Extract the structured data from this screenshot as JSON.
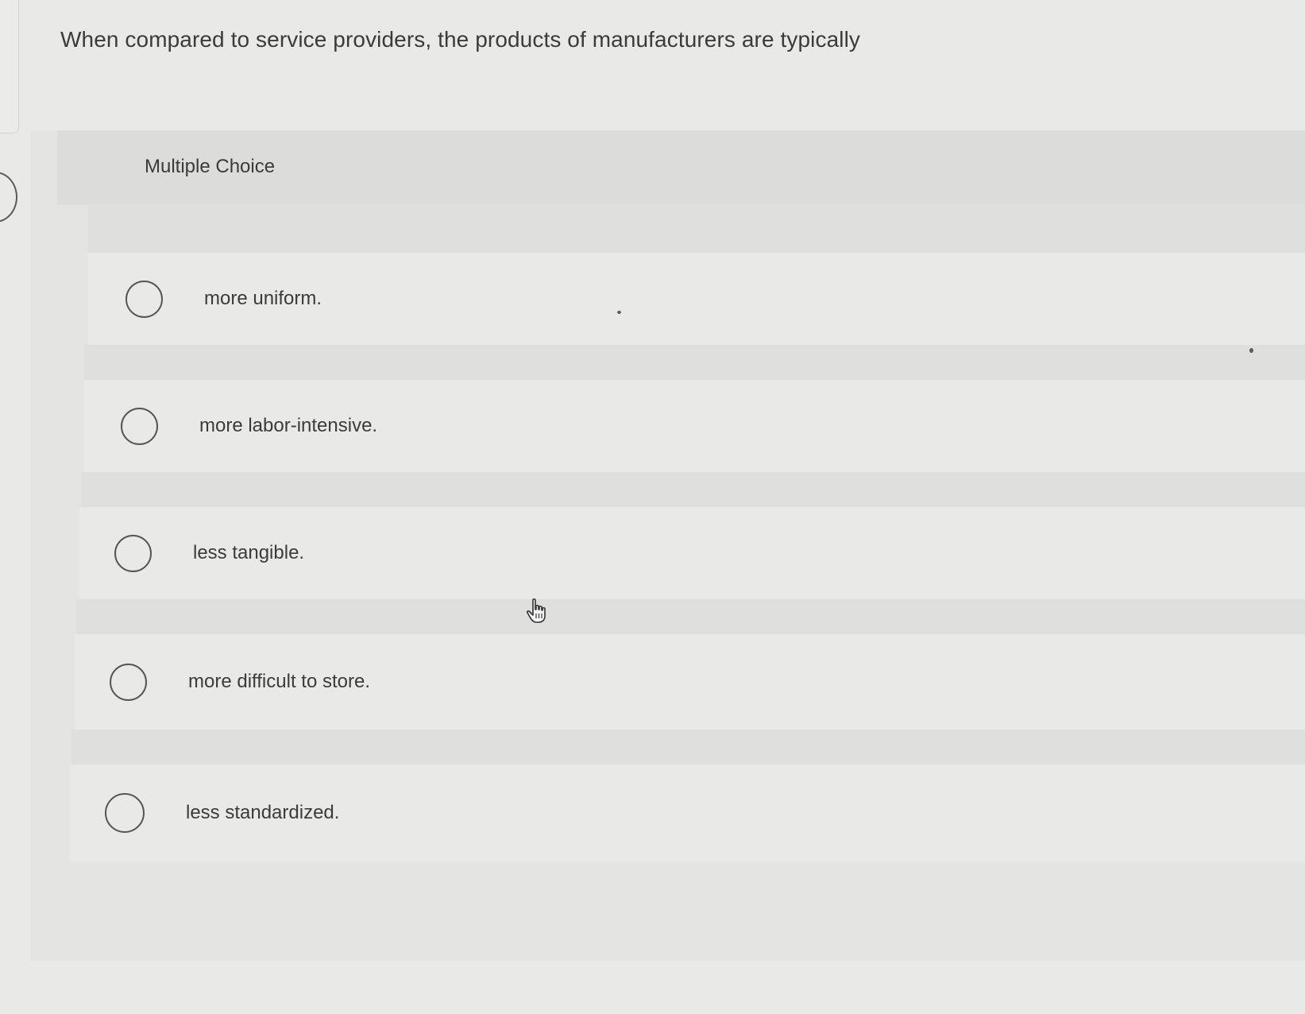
{
  "question": {
    "text": "When compared to service providers, the products of manufacturers are typically"
  },
  "card": {
    "header_label": "Multiple Choice"
  },
  "options": [
    {
      "label": "more uniform.",
      "selected": false
    },
    {
      "label": "more labor-intensive.",
      "selected": false
    },
    {
      "label": "less tangible.",
      "selected": false
    },
    {
      "label": "more difficult to store.",
      "selected": false
    },
    {
      "label": "less standardized.",
      "selected": false
    }
  ],
  "icons": {
    "radio": "radio-unchecked-icon",
    "cursor": "hand-pointer-icon"
  }
}
